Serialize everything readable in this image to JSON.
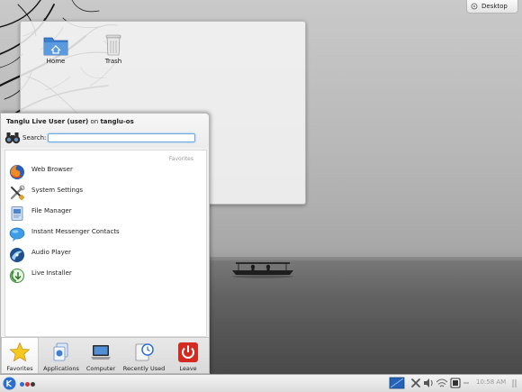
{
  "desktop": {
    "icons": [
      {
        "label": "Home",
        "icon": "home-folder-icon"
      },
      {
        "label": "Trash",
        "icon": "trash-icon"
      }
    ],
    "widget_button": "Desktop"
  },
  "kickoff": {
    "user_line_name": "Tanglu Live User (user)",
    "user_line_on": " on ",
    "user_line_host": "tanglu-os",
    "search_label": "Search:",
    "search_value": "",
    "favorites_heading": "Favorites",
    "favorites": [
      {
        "label": "Web Browser",
        "icon": "firefox-icon"
      },
      {
        "label": "System Settings",
        "icon": "settings-tools-icon"
      },
      {
        "label": "File Manager",
        "icon": "file-manager-icon"
      },
      {
        "label": "Instant Messenger Contacts",
        "icon": "chat-bubble-icon"
      },
      {
        "label": "Audio Player",
        "icon": "audio-player-icon"
      },
      {
        "label": "Live Installer",
        "icon": "installer-icon"
      }
    ],
    "tabs": [
      {
        "label": "Favorites",
        "icon": "star-icon",
        "active": true
      },
      {
        "label": "Applications",
        "icon": "applications-icon",
        "active": false
      },
      {
        "label": "Computer",
        "icon": "computer-icon",
        "active": false
      },
      {
        "label": "Recently Used",
        "icon": "recent-clock-icon",
        "active": false
      },
      {
        "label": "Leave",
        "icon": "power-icon",
        "active": false
      }
    ]
  },
  "panel": {
    "clock": "10:58 AM",
    "pager_colors": [
      "#2c6fd0",
      "#d33030",
      "#3a3a3a"
    ]
  }
}
